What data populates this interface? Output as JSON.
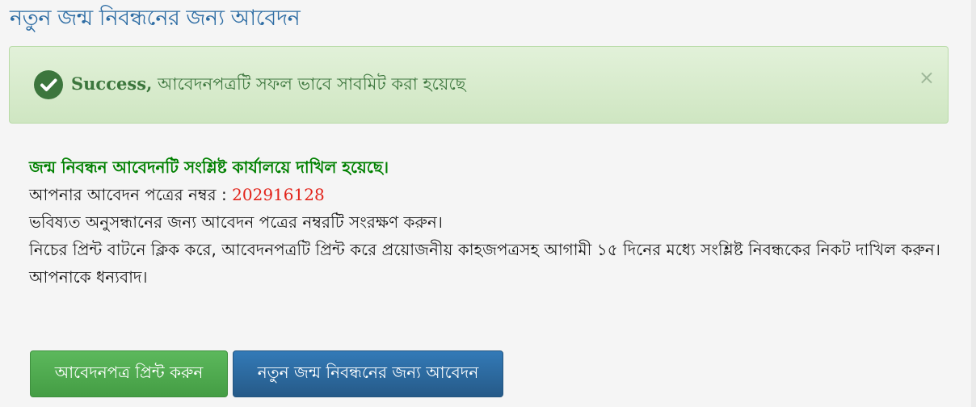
{
  "page": {
    "title": "নতুন জন্ম নিবন্ধনের জন্য আবেদন"
  },
  "alert": {
    "bold": "Success,",
    "message": " আবেদনপত্রটি সফল ভাবে সাবমিট করা হয়েছে",
    "close": "×",
    "icon": "check-circle-icon"
  },
  "info": {
    "heading": "জন্ম নিবন্ধন আবেদনটি সংশ্লিষ্ট কার্যালয়ে দাখিল হয়েছে।",
    "number_label": "আপনার আবেদন পত্রের নম্বর : ",
    "number": "202916128",
    "line3": "ভবিষ্যত অনুসন্ধানের জন্য আবেদন পত্রের নম্বরটি সংরক্ষণ করুন।",
    "line4": "নিচের প্রিন্ট বাটনে ক্লিক করে, আবেদনপত্রটি প্রিন্ট করে প্রয়োজনীয় কাহজপত্রসহ আগামী ১৫ দিনের মধ্যে সংশ্লিষ্ট নিবন্ধকের নিকট দাখিল করুন।",
    "line5": "আপনাকে ধন্যবাদ।"
  },
  "buttons": {
    "print": "আবেদনপত্র প্রিন্ট করুন",
    "new_application": "নতুন জন্ম নিবন্ধনের জন্য আবেদন"
  },
  "colors": {
    "title": "#2e6da4",
    "success": "#3c763d",
    "heading": "#008000",
    "number": "#e2231a",
    "btn_print": "#5cb85c",
    "btn_new": "#337ab7"
  }
}
